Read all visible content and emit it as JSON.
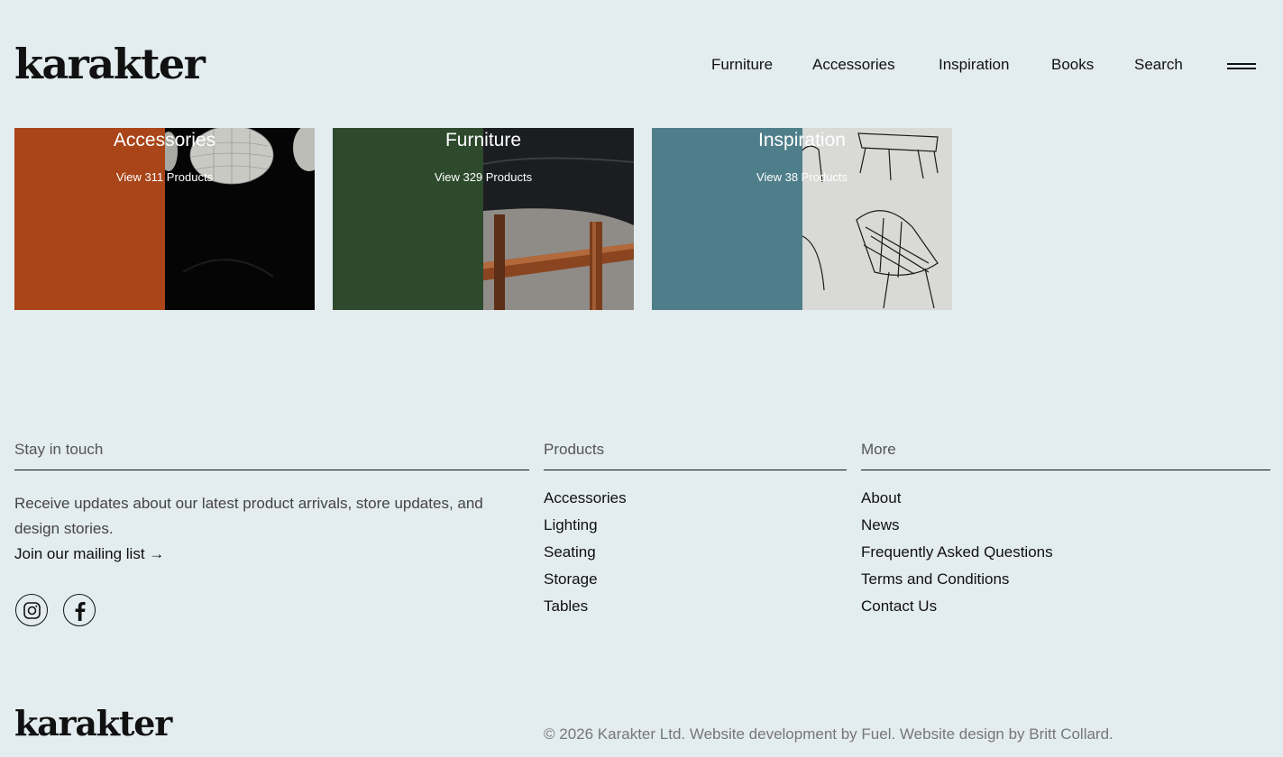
{
  "brand": {
    "logo": "karakter"
  },
  "nav": {
    "items": [
      "Furniture",
      "Accessories",
      "Inspiration",
      "Books",
      "Search"
    ],
    "menu_icon": "hamburger-icon"
  },
  "categories": [
    {
      "title": "Accessories",
      "count": "View 311 Products",
      "color": "#a94519"
    },
    {
      "title": "Furniture",
      "count": "View 329 Products",
      "color": "#2d4a2d"
    },
    {
      "title": "Inspiration",
      "count": "View 38 Products",
      "color": "#4e7e8a"
    }
  ],
  "footer": {
    "stay": {
      "heading": "Stay in touch",
      "text": "Receive updates about our latest product arrivals, store updates, and design stories.",
      "link": "Join our mailing list →",
      "social_icons": [
        "instagram-icon",
        "facebook-icon"
      ]
    },
    "products": {
      "heading": "Products",
      "links": [
        "Accessories",
        "Lighting",
        "Seating",
        "Storage",
        "Tables"
      ]
    },
    "more": {
      "heading": "More",
      "links": [
        "About",
        "News",
        "Frequently Asked Questions",
        "Terms and Conditions",
        "Contact Us"
      ]
    },
    "logo": "karakter",
    "copyright": "© 2026 Karakter Ltd. Website development by Fuel. Website design by Britt Collard."
  }
}
